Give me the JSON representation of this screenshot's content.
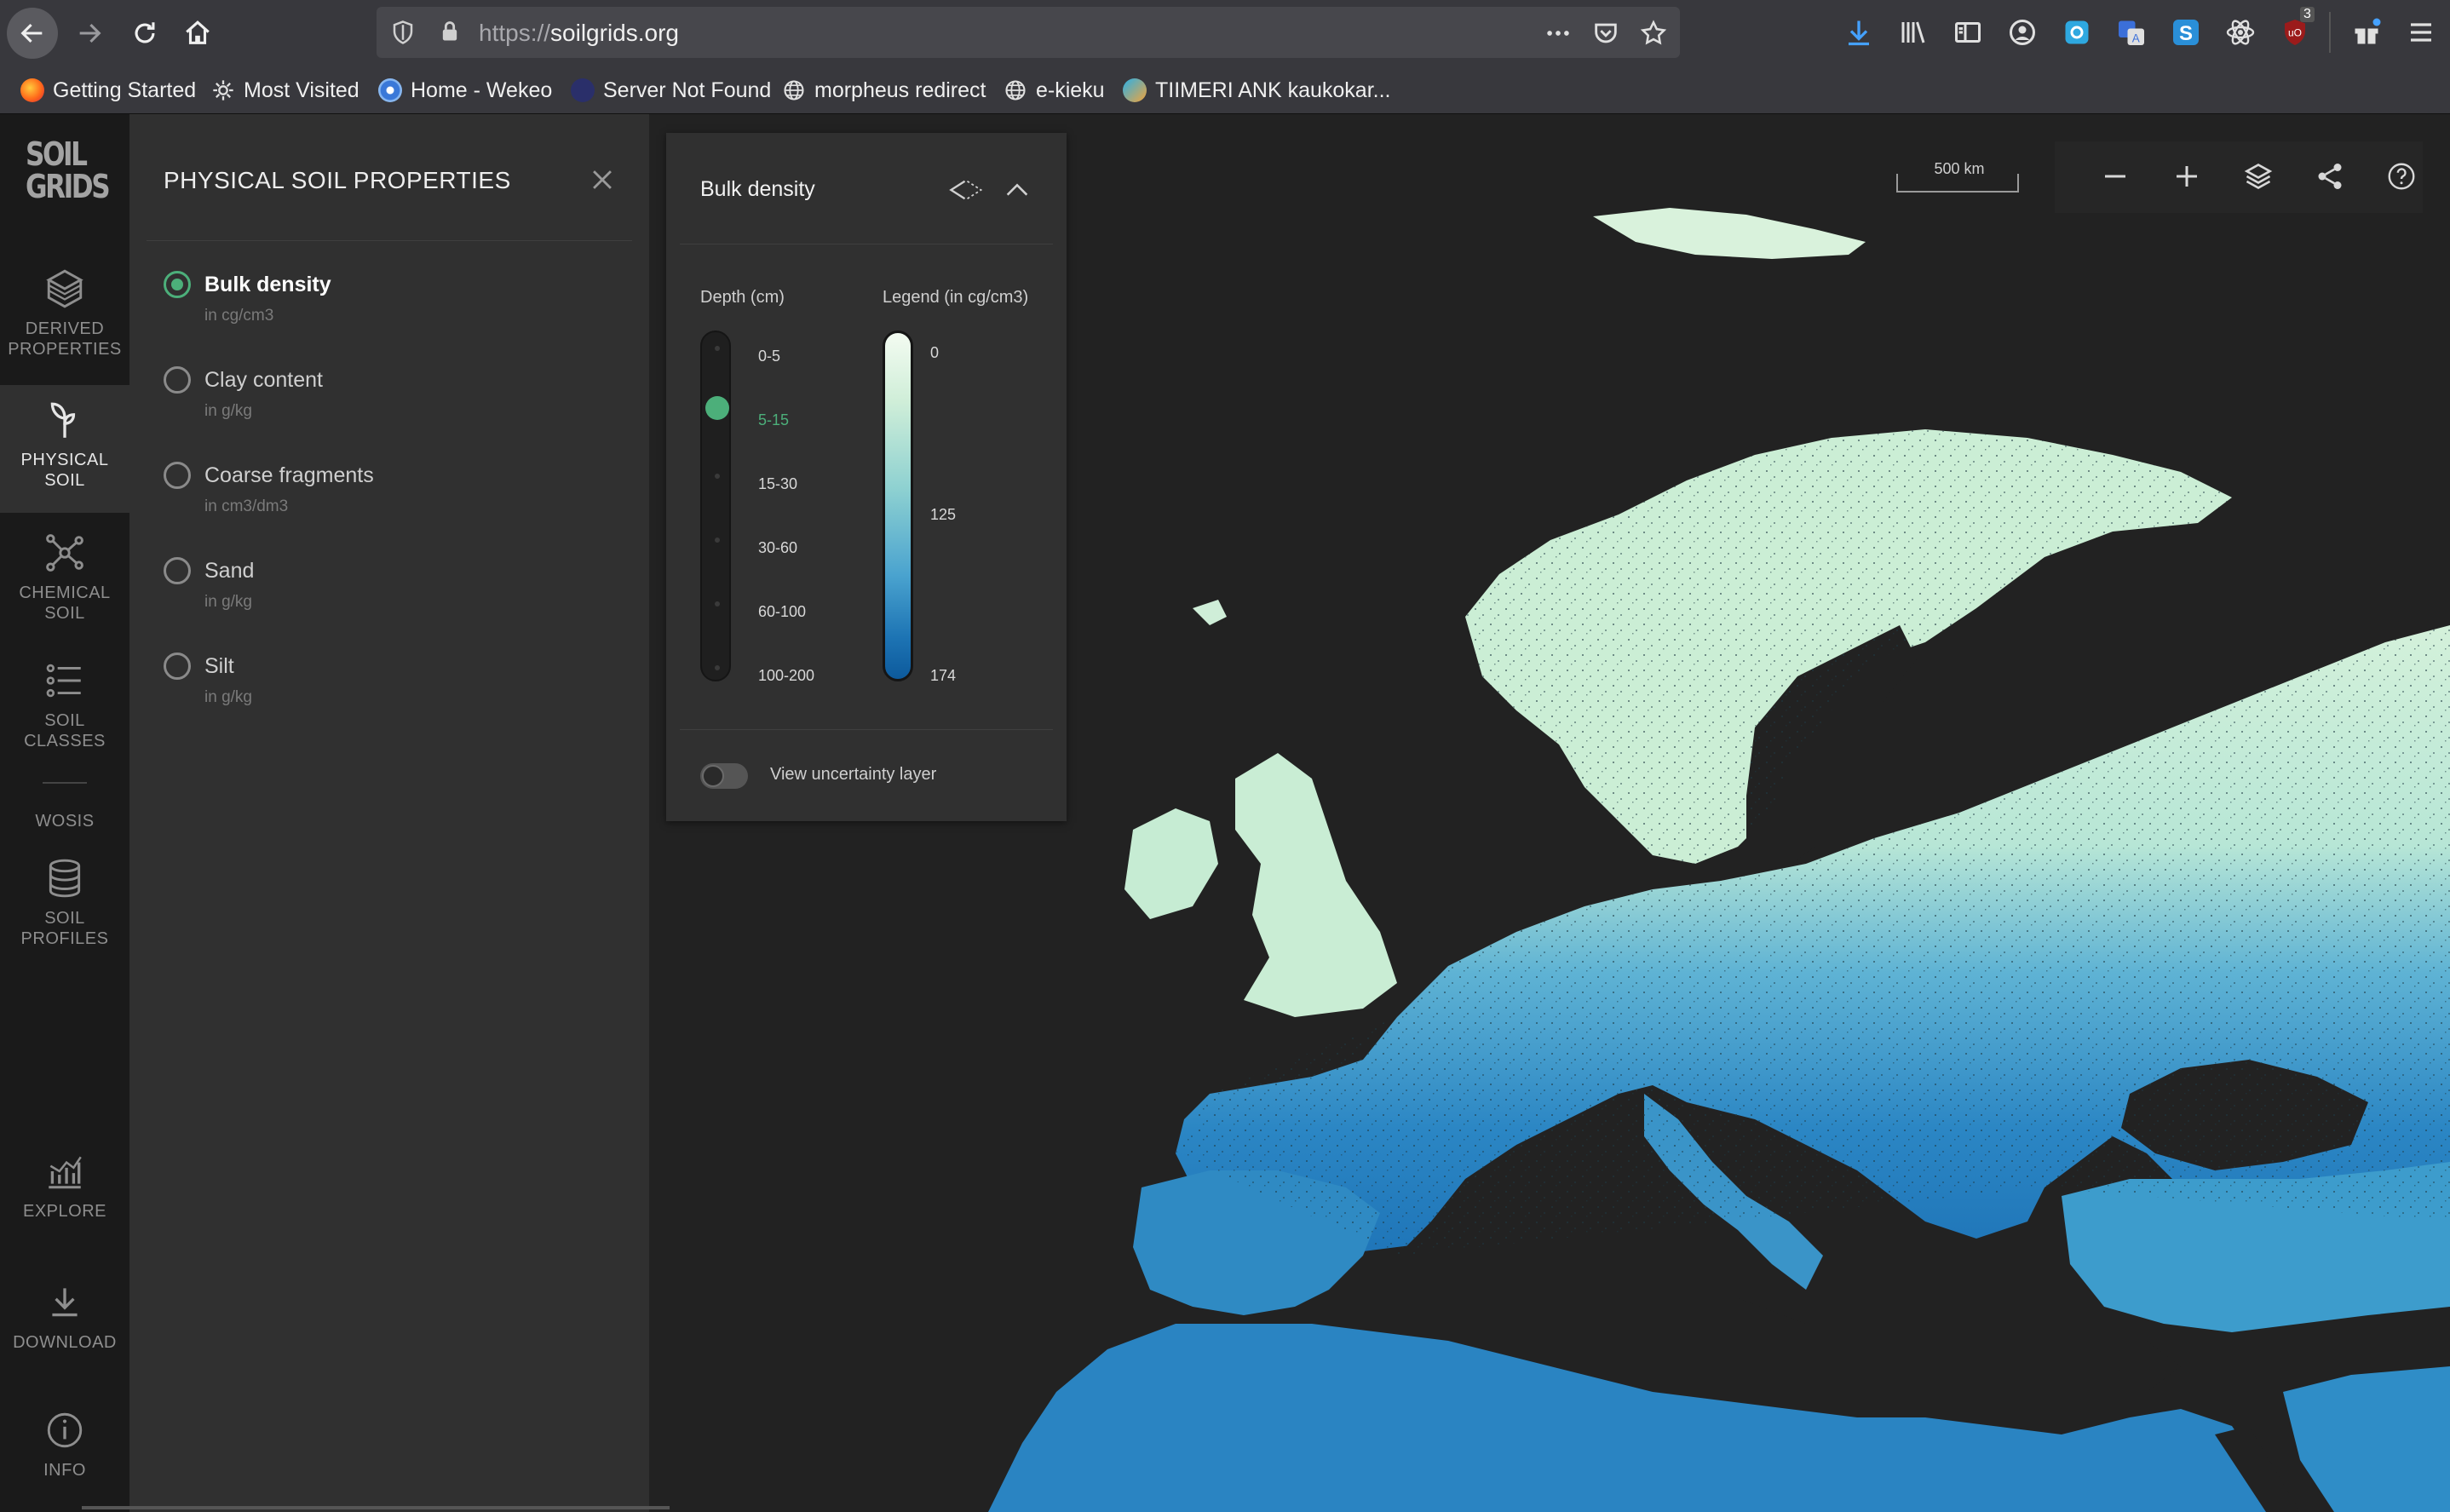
{
  "browser": {
    "url_scheme": "https://",
    "url_host": "soilgrids.org",
    "ublock_count": "3",
    "bookmarks": [
      {
        "label": "Getting Started",
        "icon": "firefox-icon"
      },
      {
        "label": "Most Visited",
        "icon": "gear-icon"
      },
      {
        "label": "Home - Wekeo",
        "icon": "wekeo-icon"
      },
      {
        "label": "Server Not Found",
        "icon": "globe-dark-icon"
      },
      {
        "label": "morpheus redirect",
        "icon": "globe-icon"
      },
      {
        "label": "e-kieku",
        "icon": "globe-icon"
      },
      {
        "label": "TIIMERI ANK kaukokar...",
        "icon": "tiimeri-icon"
      }
    ]
  },
  "rail": {
    "logo_line1": "SOIL",
    "logo_line2": "GRIDS",
    "items": [
      {
        "line1": "DERIVED",
        "line2": "PROPERTIES",
        "icon": "layers-cube-icon"
      },
      {
        "line1": "PHYSICAL",
        "line2": "SOIL",
        "icon": "sprout-icon",
        "active": true
      },
      {
        "line1": "CHEMICAL",
        "line2": "SOIL",
        "icon": "molecule-icon"
      },
      {
        "line1": "SOIL",
        "line2": "CLASSES",
        "icon": "list-icon"
      },
      {
        "line1": "WOSIS",
        "line2": ""
      },
      {
        "line1": "SOIL",
        "line2": "PROFILES",
        "icon": "database-icon"
      },
      {
        "line1": "EXPLORE",
        "line2": "",
        "icon": "bar-chart-icon"
      },
      {
        "line1": "DOWNLOAD",
        "line2": "",
        "icon": "download-icon"
      },
      {
        "line1": "INFO",
        "line2": "",
        "icon": "info-icon"
      }
    ]
  },
  "panel": {
    "title": "PHYSICAL SOIL PROPERTIES",
    "properties": [
      {
        "name": "Bulk density",
        "unit": "in cg/cm3",
        "selected": true
      },
      {
        "name": "Clay content",
        "unit": "in g/kg",
        "selected": false
      },
      {
        "name": "Coarse fragments",
        "unit": "in cm3/dm3",
        "selected": false
      },
      {
        "name": "Sand",
        "unit": "in g/kg",
        "selected": false
      },
      {
        "name": "Silt",
        "unit": "in g/kg",
        "selected": false
      }
    ]
  },
  "legend": {
    "title": "Bulk density",
    "depth_label": "Depth (cm)",
    "legend_label": "Legend (in cg/cm3)",
    "depths": [
      "0-5",
      "5-15",
      "15-30",
      "30-60",
      "60-100",
      "100-200"
    ],
    "selected_depth": "5-15",
    "values": [
      "0",
      "125",
      "174"
    ],
    "colors": {
      "low": "#f3fbf1",
      "mid": "#8ed1d1",
      "high": "#0d5a9c"
    },
    "uncertainty_label": "View uncertainty layer",
    "uncertainty_on": false
  },
  "map": {
    "scale_label": "500 km",
    "colors": {
      "ocean": "#222222",
      "land_light": "#cdeed6",
      "land_blue": "#2b86c4"
    }
  }
}
